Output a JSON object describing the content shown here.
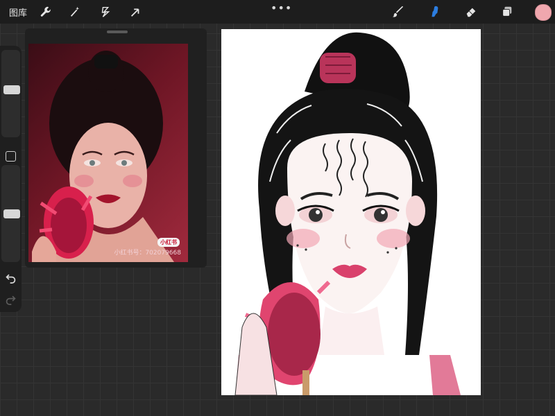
{
  "topbar": {
    "gallery_label": "图库",
    "tools_left": [
      "wrench-icon",
      "magic-wand-icon",
      "selection-icon",
      "transform-arrow-icon"
    ],
    "more_label": "•••",
    "tools_right": [
      "brush-icon",
      "smudge-icon",
      "eraser-icon",
      "layers-icon"
    ],
    "active_tool": "smudge-icon",
    "current_color": "#f0a7ae"
  },
  "sidebar": {
    "brush_size_level": 0.55,
    "opacity_level": 0.5
  },
  "reference": {
    "watermark_logo": "小红书",
    "watermark_id": "小红书号：702079668"
  },
  "colors": {
    "accent_blue": "#2c7de0",
    "canvas_bg": "#ffffff",
    "lip_pink": "#d9416c",
    "fruit_red": "#b92f4e"
  }
}
